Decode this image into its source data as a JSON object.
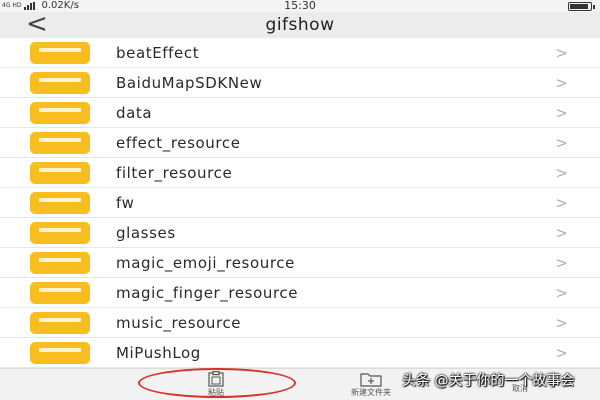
{
  "status_bar": {
    "carrier": "4G HD",
    "network_speed": "0.02K/s",
    "time": "15:30"
  },
  "title_bar": {
    "back_icon": "chevron-left-icon",
    "title": "gifshow"
  },
  "folders": [
    {
      "name": "beatEffect"
    },
    {
      "name": "BaiduMapSDKNew"
    },
    {
      "name": "data"
    },
    {
      "name": "effect_resource"
    },
    {
      "name": "filter_resource"
    },
    {
      "name": "fw"
    },
    {
      "name": "glasses"
    },
    {
      "name": "magic_emoji_resource"
    },
    {
      "name": "magic_finger_resource"
    },
    {
      "name": "music_resource"
    },
    {
      "name": "MiPushLog"
    }
  ],
  "row_chevron": ">",
  "bottom_bar": {
    "paste_label": "粘贴",
    "new_folder_label": "新建文件夹",
    "third_label": "取消"
  },
  "watermark": "头条 @关于你的一个故事会",
  "colors": {
    "folder": "#f8bd1e",
    "highlight_circle": "#d8302a"
  }
}
